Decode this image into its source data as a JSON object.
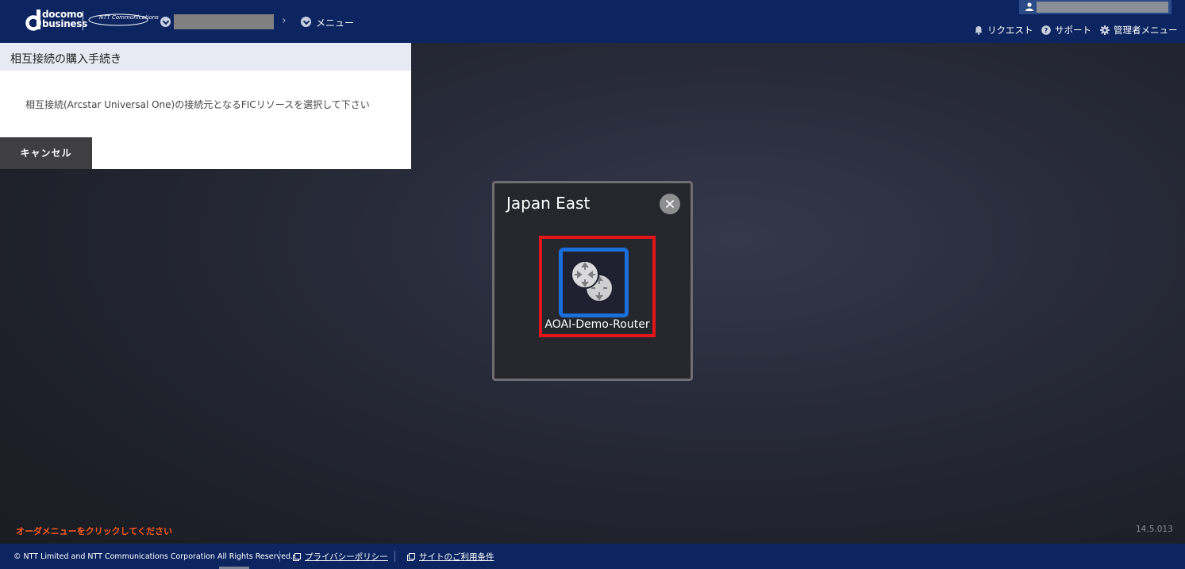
{
  "header": {
    "brand_top": "docomo",
    "brand_bottom": "business",
    "partner": "NTT Communications",
    "breadcrumb_menu": "メニュー",
    "links": {
      "request": "リクエスト",
      "support": "サポート",
      "admin": "管理者メニュー"
    }
  },
  "panel": {
    "title": "相互接続の購入手続き",
    "message": "相互接続(Arcstar Universal One)の接続元となるFICリソースを選択して下さい",
    "cancel_label": "キャンセル"
  },
  "modal": {
    "title": "Japan East",
    "router_label": "AOAI-Demo-Router"
  },
  "status": {
    "order_hint": "オーダメニューをクリックしてください",
    "version": "14.5.013"
  },
  "footer": {
    "copyright": "© NTT Limited and NTT Communications Corporation All Rights Reserved.",
    "privacy": "プライバシーポリシー",
    "terms": "サイトのご利用条件"
  },
  "colors": {
    "header_bg": "#0c2560",
    "highlight": "#e2151b",
    "router_border": "#1a6fd9",
    "hint": "#ff5a1f"
  }
}
